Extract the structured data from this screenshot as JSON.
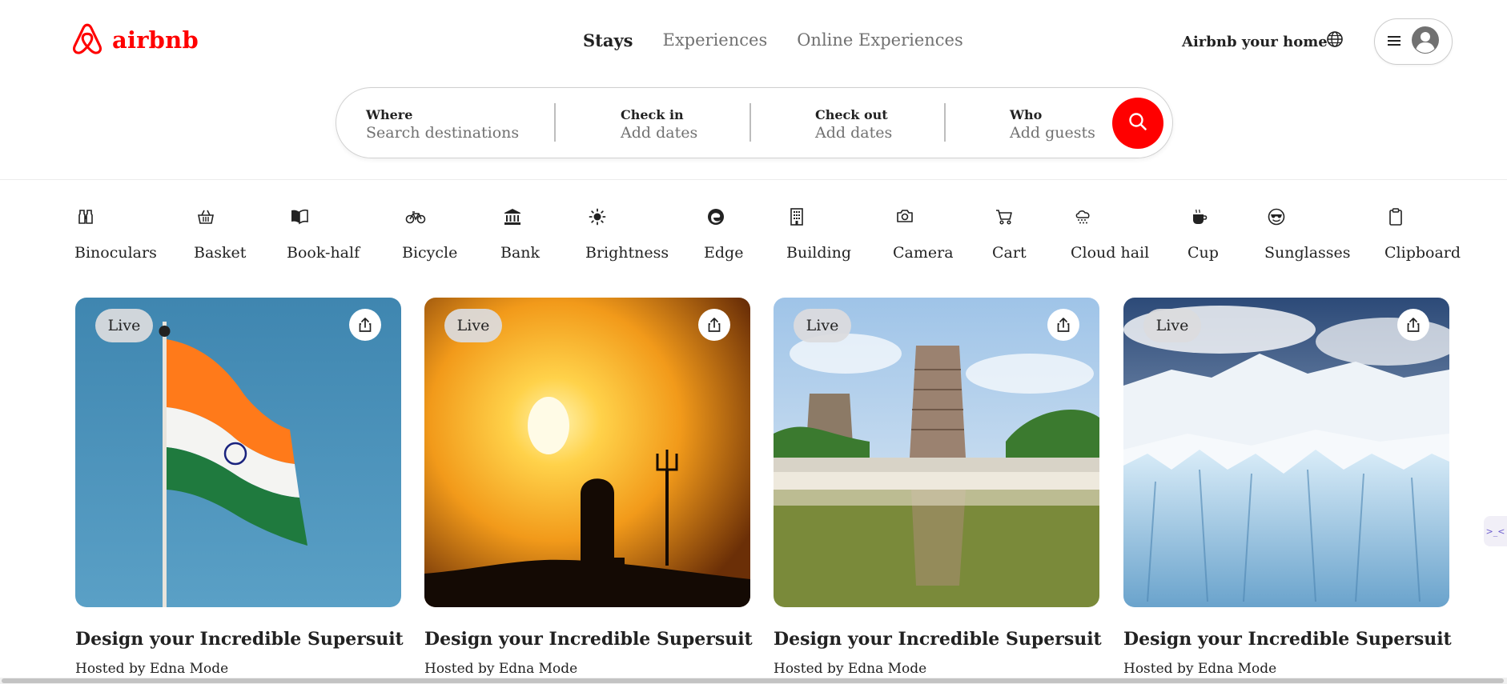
{
  "brand": {
    "name": "airbnb",
    "color": "#ff0000",
    "icon": "airbnb-logo-icon"
  },
  "nav": {
    "tabs": [
      {
        "label": "Stays",
        "active": true
      },
      {
        "label": "Experiences",
        "active": false
      },
      {
        "label": "Online Experiences",
        "active": false
      }
    ]
  },
  "header": {
    "host_link": "Airbnb your home",
    "globe_icon": "globe-icon",
    "menu_icon": "hamburger-icon",
    "avatar_icon": "user-avatar-icon"
  },
  "search": {
    "where": {
      "label": "Where",
      "placeholder": "Search destinations"
    },
    "checkin": {
      "label": "Check in",
      "placeholder": "Add dates"
    },
    "checkout": {
      "label": "Check out",
      "placeholder": "Add dates"
    },
    "who": {
      "label": "Who",
      "placeholder": "Add guests"
    },
    "button_icon": "search-icon",
    "button_color": "#ff0000"
  },
  "categories": [
    {
      "label": "Binoculars",
      "icon": "binoculars-icon"
    },
    {
      "label": "Basket",
      "icon": "basket-icon"
    },
    {
      "label": "Book-half",
      "icon": "book-half-icon"
    },
    {
      "label": "Bicycle",
      "icon": "bicycle-icon"
    },
    {
      "label": "Bank",
      "icon": "bank-icon"
    },
    {
      "label": "Brightness",
      "icon": "brightness-icon"
    },
    {
      "label": "Edge",
      "icon": "edge-icon"
    },
    {
      "label": "Building",
      "icon": "building-icon"
    },
    {
      "label": "Camera",
      "icon": "camera-icon"
    },
    {
      "label": "Cart",
      "icon": "cart-icon"
    },
    {
      "label": "Cloud hail",
      "icon": "cloud-hail-icon"
    },
    {
      "label": "Cup",
      "icon": "cup-icon"
    },
    {
      "label": "Sunglasses",
      "icon": "sunglasses-icon"
    },
    {
      "label": "Clipboard",
      "icon": "clipboard-icon"
    }
  ],
  "cards": [
    {
      "badge": "Live",
      "title": "Design your Incredible Supersuit",
      "subtitle": "Hosted by Edna Mode",
      "image": "indian-flag-photo"
    },
    {
      "badge": "Live",
      "title": "Design your Incredible Supersuit",
      "subtitle": "Hosted by Edna Mode",
      "image": "sunset-shiva-lingam-photo"
    },
    {
      "badge": "Live",
      "title": "Design your Incredible Supersuit",
      "subtitle": "Hosted by Edna Mode",
      "image": "temple-tank-reflection-photo"
    },
    {
      "badge": "Live",
      "title": "Design your Incredible Supersuit",
      "subtitle": "Hosted by Edna Mode",
      "image": "glacier-photo"
    }
  ],
  "side_tab": {
    "label": ">_<"
  }
}
